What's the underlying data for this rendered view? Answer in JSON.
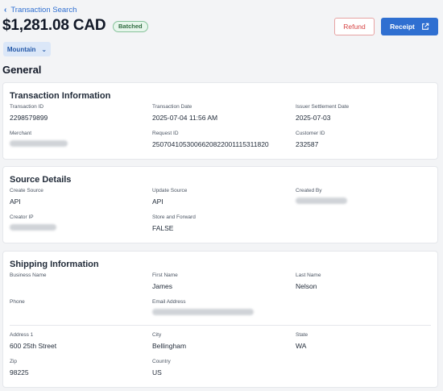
{
  "breadcrumb": {
    "label": "Transaction Search"
  },
  "header": {
    "amount": "$1,281.08 CAD",
    "status_badge": "Batched",
    "refund_label": "Refund",
    "receipt_label": "Receipt",
    "timezone": "Mountain",
    "section_title": "General"
  },
  "colors": {
    "accent": "#2f6fd1",
    "refund": "#d64545",
    "batched_badge": "#2f6b40"
  },
  "transaction": {
    "title": "Transaction Information",
    "transaction_id_label": "Transaction ID",
    "transaction_id": "2298579899",
    "transaction_date_label": "Transaction Date",
    "transaction_date": "2025-07-04 11:56 AM",
    "issuer_settlement_label": "Issuer Settlement Date",
    "issuer_settlement": "2025-07-03",
    "merchant_label": "Merchant",
    "request_id_label": "Request ID",
    "request_id": "2507041053006620822001115311820",
    "customer_id_label": "Customer ID",
    "customer_id": "232587"
  },
  "source": {
    "title": "Source Details",
    "create_source_label": "Create Source",
    "create_source": "API",
    "update_source_label": "Update Source",
    "update_source": "API",
    "created_by_label": "Created By",
    "creator_ip_label": "Creator IP",
    "store_forward_label": "Store and Forward",
    "store_forward": "FALSE"
  },
  "shipping": {
    "title": "Shipping Information",
    "business_name_label": "Business Name",
    "first_name_label": "First Name",
    "first_name": "James",
    "last_name_label": "Last Name",
    "last_name": "Nelson",
    "phone_label": "Phone",
    "email_label": "Email Address",
    "address1_label": "Address 1",
    "address1": "600 25th Street",
    "city_label": "City",
    "city": "Bellingham",
    "state_label": "State",
    "state": "WA",
    "zip_label": "Zip",
    "zip": "98225",
    "country_label": "Country",
    "country": "US"
  }
}
